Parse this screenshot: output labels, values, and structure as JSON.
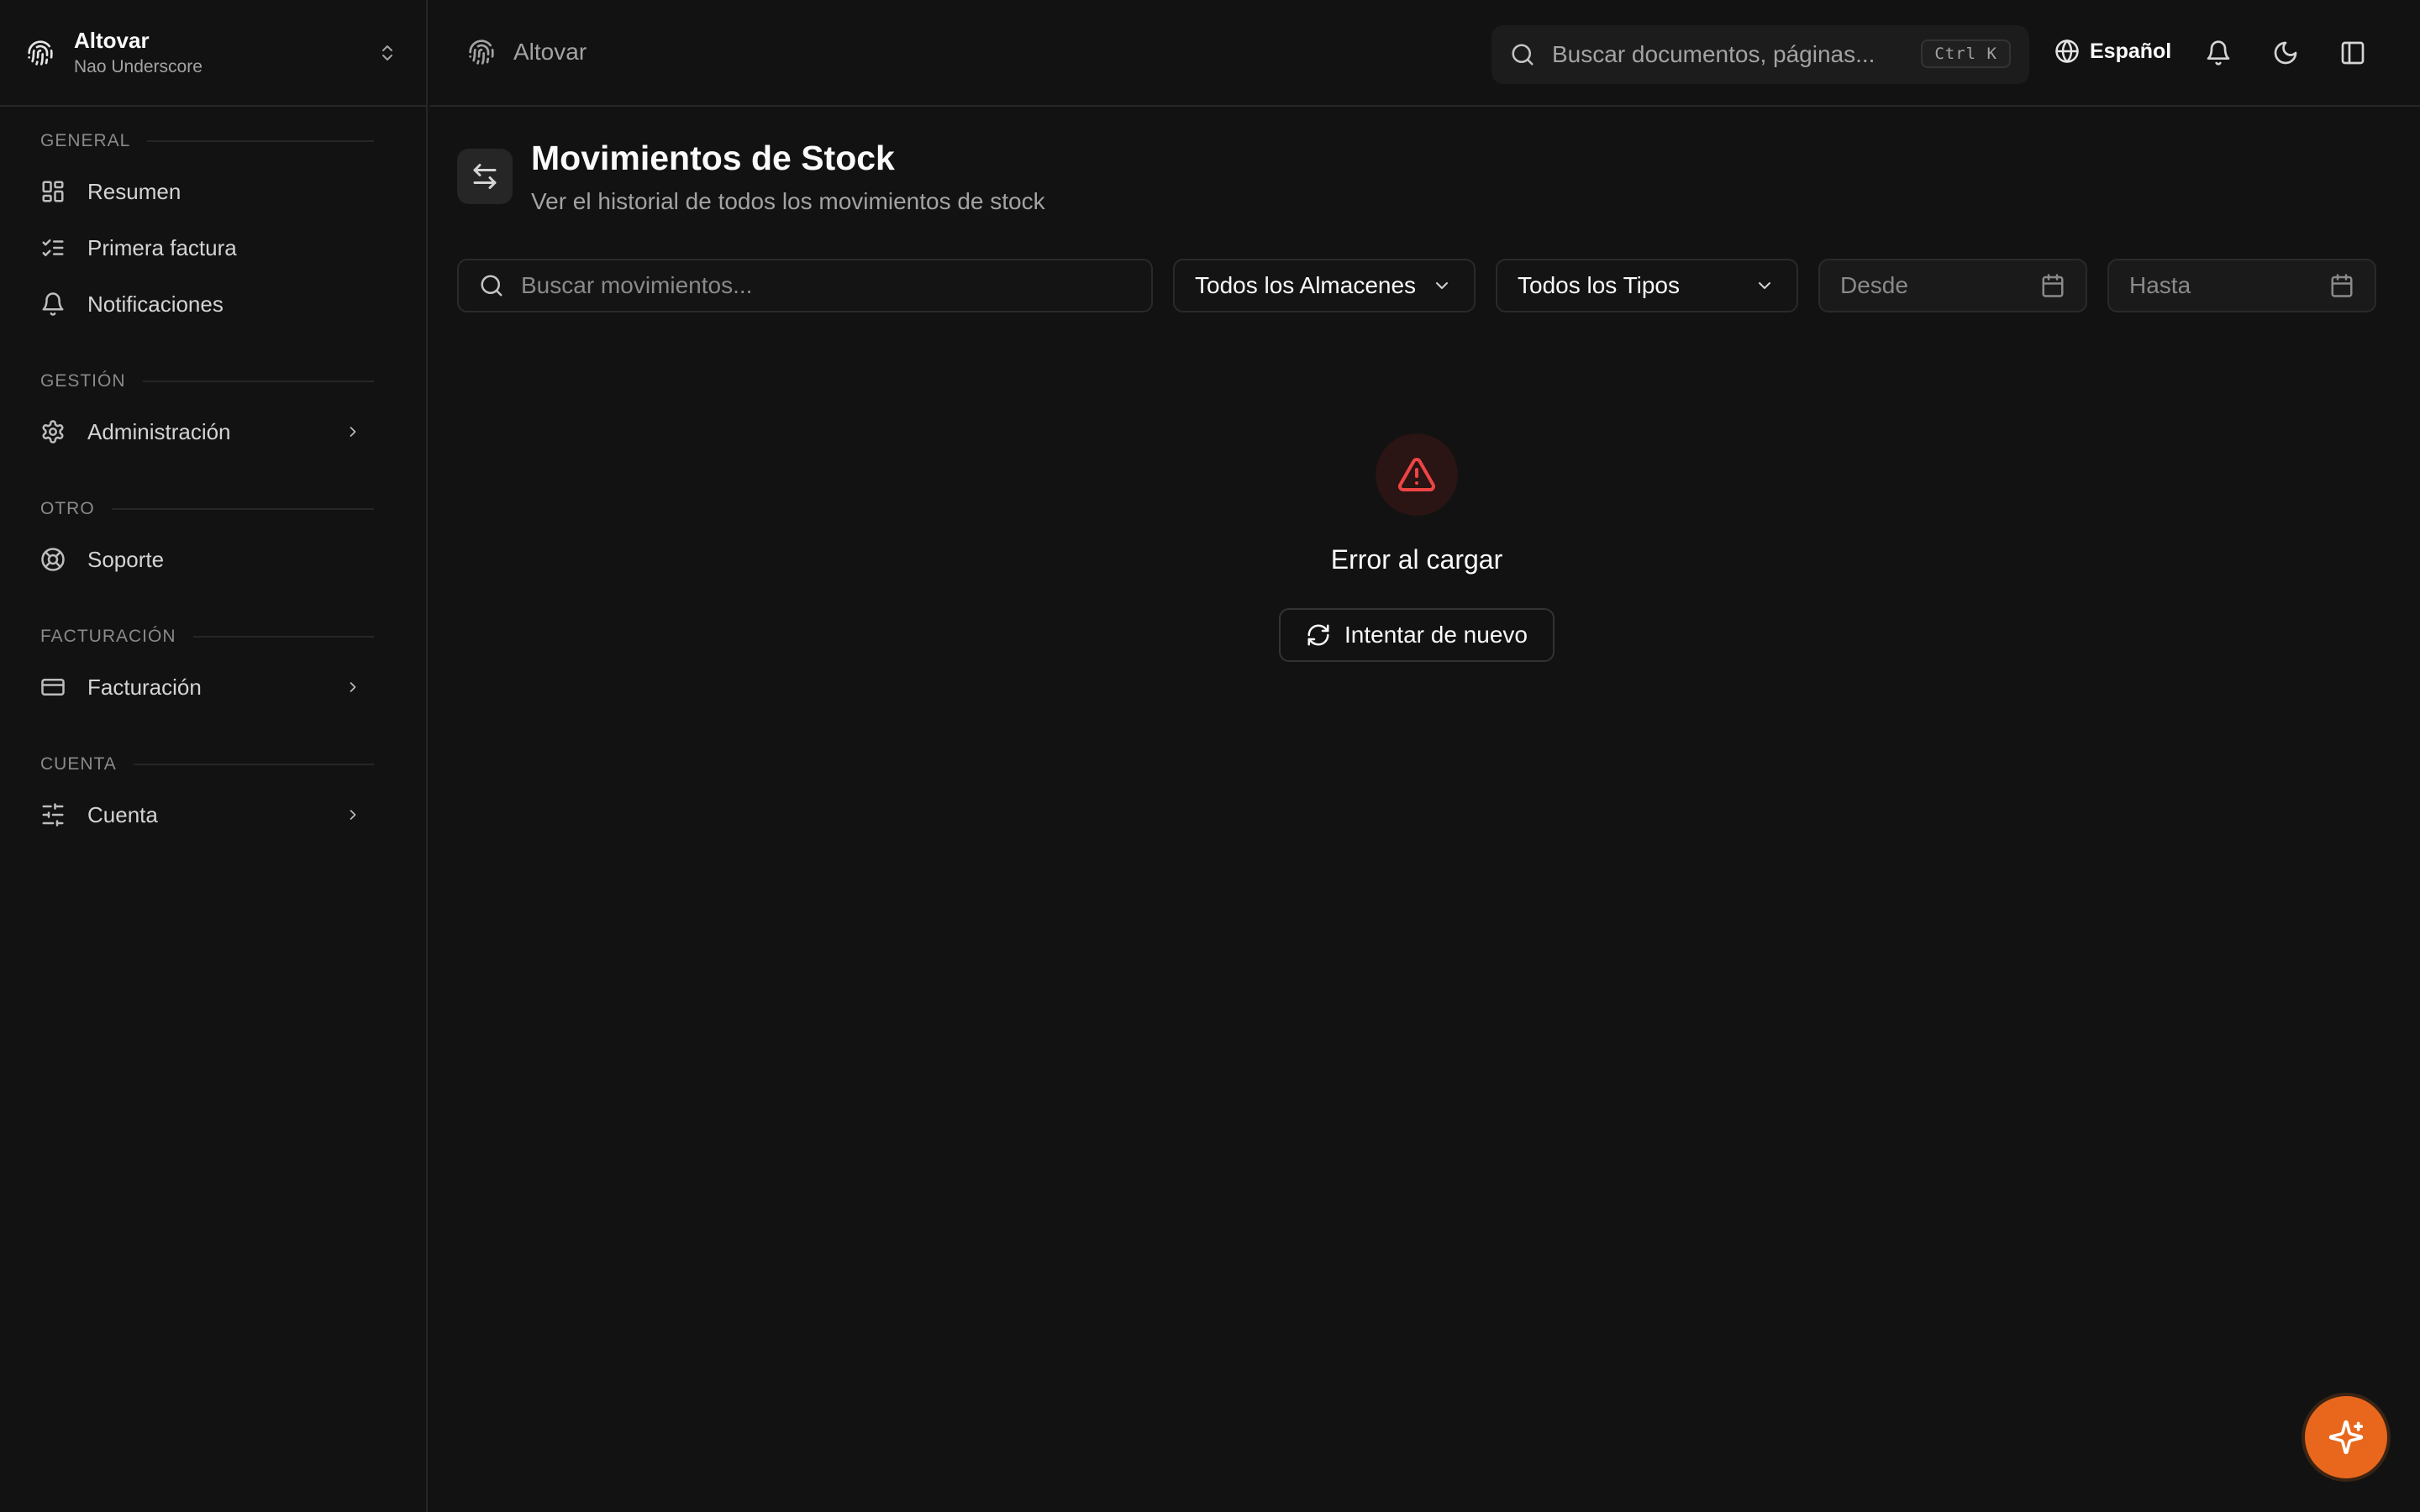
{
  "sidebar": {
    "org_name": "Altovar",
    "org_sub": "Nao Underscore",
    "sections": {
      "general": "GENERAL",
      "gestion": "GESTIÓN",
      "otro": "OTRO",
      "facturacion": "FACTURACIÓN",
      "cuenta": "CUENTA"
    },
    "items": {
      "resumen": "Resumen",
      "primera_factura": "Primera factura",
      "notificaciones": "Notificaciones",
      "administracion": "Administración",
      "soporte": "Soporte",
      "facturacion": "Facturación",
      "cuenta": "Cuenta"
    }
  },
  "topbar": {
    "breadcrumb": "Altovar",
    "search_placeholder": "Buscar documentos, páginas...",
    "shortcut": "Ctrl K",
    "language": "Español"
  },
  "page": {
    "title": "Movimientos de Stock",
    "subtitle": "Ver el historial de todos los movimientos de stock"
  },
  "filters": {
    "search_placeholder": "Buscar movimientos...",
    "warehouse": "Todos los Almacenes",
    "type": "Todos los Tipos",
    "from_placeholder": "Desde",
    "to_placeholder": "Hasta"
  },
  "error": {
    "title": "Error al cargar",
    "retry": "Intentar de nuevo"
  },
  "colors": {
    "background": "#121212",
    "error": "#ef4444",
    "accent": "#e8671c"
  }
}
